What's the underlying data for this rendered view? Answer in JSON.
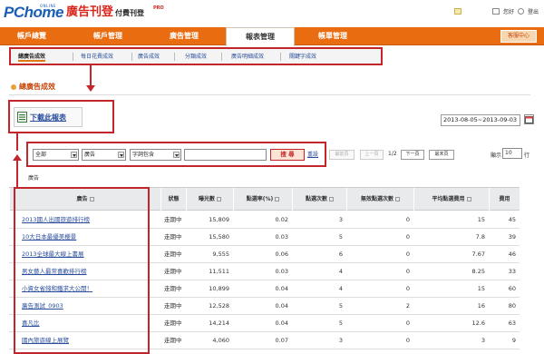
{
  "header": {
    "logo_main": "PChome",
    "logo_online": "ONLINE",
    "logo_zh": "廣告刊登",
    "logo_pro": "PRO",
    "logo_sub": "付費刊登",
    "user": "您好",
    "logout": "登出"
  },
  "nav": {
    "items": [
      "帳戶總覽",
      "帳戶管理",
      "廣告管理",
      "報表管理",
      "帳單管理"
    ],
    "active": "報表管理",
    "button": "客服中心"
  },
  "subnav": {
    "items": [
      "總廣告成效",
      "每日花費成效",
      "廣告成效",
      "分類成效",
      "廣告明細成效",
      "關鍵字成效"
    ]
  },
  "page": {
    "title": "總廣告成效",
    "download_label": "下載此報表",
    "date_range": "2013-08-05~2013-09-03"
  },
  "filter": {
    "sel1": "全部",
    "sel2": "廣告",
    "sel3": "字詞包含",
    "search_value": "",
    "search_button": "搜 尋",
    "reset": "重設"
  },
  "pager": {
    "first": "最前頁",
    "prev": "上一頁",
    "page_info": "1/2",
    "next": "下一頁",
    "last": "最末頁",
    "show_label": "顯示",
    "show_value": "10",
    "row_label": "行"
  },
  "table_label": "廣告",
  "table": {
    "headers": [
      "廣告",
      "狀態",
      "曝光數",
      "點選率(%)",
      "點選次數",
      "無效點選次數",
      "平均點選費用",
      "費用"
    ],
    "rows": [
      [
        "2013國人出國旅遊排行榜",
        "走期中",
        "15,809",
        "0.02",
        "3",
        "0",
        "15",
        "45"
      ],
      [
        "10大日本最優美櫻景",
        "走期中",
        "15,580",
        "0.03",
        "5",
        "0",
        "7.8",
        "39"
      ],
      [
        "2013全球最大線上書展",
        "走期中",
        "9,555",
        "0.06",
        "6",
        "0",
        "7.67",
        "46"
      ],
      [
        "男女藝人最常喜歡排行榜",
        "走期中",
        "11,511",
        "0.03",
        "4",
        "0",
        "8.25",
        "33"
      ],
      [
        "小資女省錢和鐵求大公開！",
        "走期中",
        "10,899",
        "0.04",
        "4",
        "0",
        "15",
        "60"
      ],
      [
        "廣告測試_0903",
        "走期中",
        "12,528",
        "0.04",
        "5",
        "2",
        "16",
        "80"
      ],
      [
        "喜凡比",
        "走期中",
        "14,214",
        "0.04",
        "5",
        "0",
        "12.6",
        "63"
      ],
      [
        "國內旅遊線上展覽",
        "走期中",
        "4,060",
        "0.07",
        "3",
        "0",
        "3",
        "9"
      ]
    ]
  }
}
